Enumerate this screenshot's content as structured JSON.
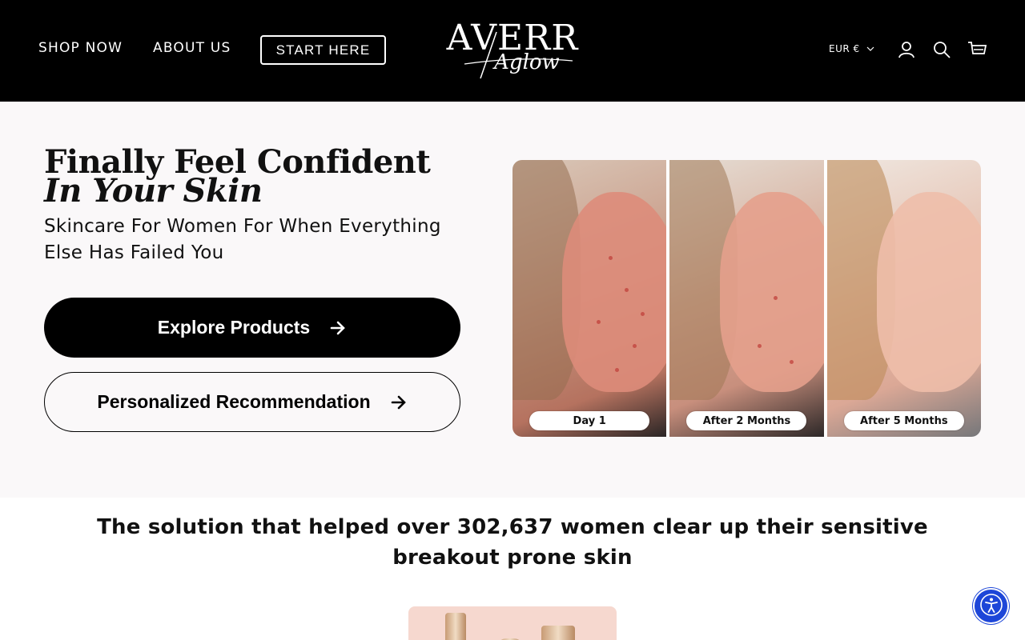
{
  "header": {
    "nav": {
      "shop_now": "SHOP NOW",
      "about_us": "ABOUT US",
      "start_here": "START HERE"
    },
    "logo": {
      "main": "AVERR",
      "script": "Aglow"
    },
    "currency": "EUR €",
    "icons": [
      "account-icon",
      "search-icon",
      "cart-icon"
    ]
  },
  "hero": {
    "title_line1": "Finally Feel Confident",
    "title_line2": "In Your Skin",
    "subtitle": "Skincare For Women For When Everything Else Has Failed You",
    "explore_button": "Explore Products",
    "personal_button": "Personalized Recommendation",
    "image_tags": [
      "Day 1",
      "After 2 Months",
      "After 5 Months"
    ]
  },
  "solution": {
    "headline": "The solution that helped over 302,637 women clear up their sensitive breakout prone skin"
  },
  "colors": {
    "header_bg": "#000000",
    "hero_bg": "#faf8f9",
    "accessibility_blue": "#1d46d8"
  }
}
